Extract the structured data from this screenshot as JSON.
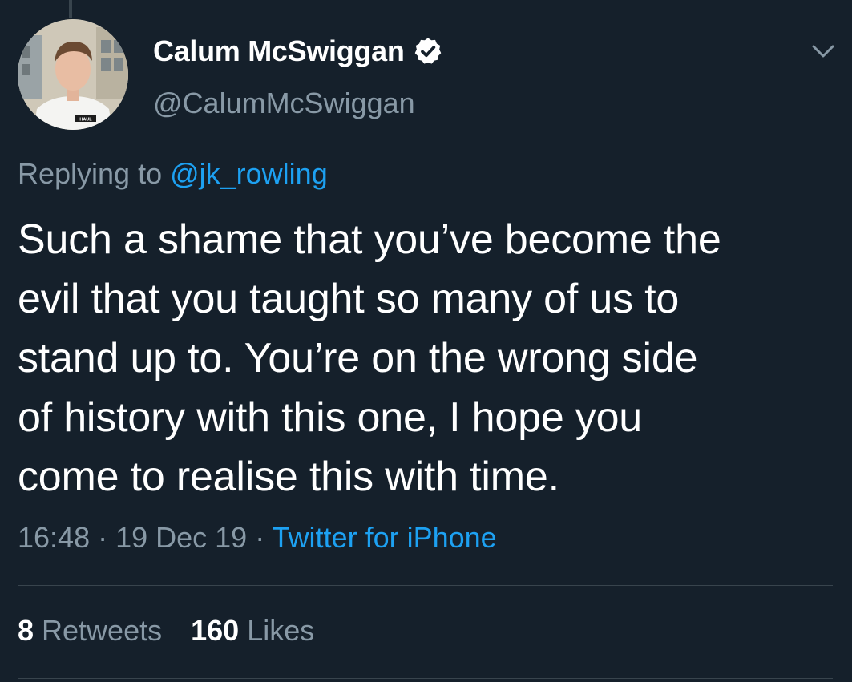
{
  "author": {
    "display_name": "Calum McSwiggan",
    "handle": "@CalumMcSwiggan",
    "avatar_shirt_text": "HAUL",
    "verified_icon": "verified-badge-icon"
  },
  "reply": {
    "prefix": "Replying to ",
    "mention": "@jk_rowling"
  },
  "tweet": {
    "lines": [
      "Such a shame that you’ve become the",
      "evil that you taught so many of us to",
      "stand up to. You’re on the wrong side",
      "of history with this one, I hope you",
      "come to realise this with time."
    ]
  },
  "meta": {
    "time": "16:48",
    "separator": " · ",
    "date": "19 Dec 19",
    "source": "Twitter for iPhone"
  },
  "stats": {
    "retweets_count": "8",
    "retweets_label": " Retweets",
    "likes_count": "160",
    "likes_label": " Likes"
  },
  "colors": {
    "background": "#15202b",
    "primary_text": "#ffffff",
    "secondary_text": "#8899a6",
    "accent": "#1da1f2",
    "divider": "#38444d"
  }
}
